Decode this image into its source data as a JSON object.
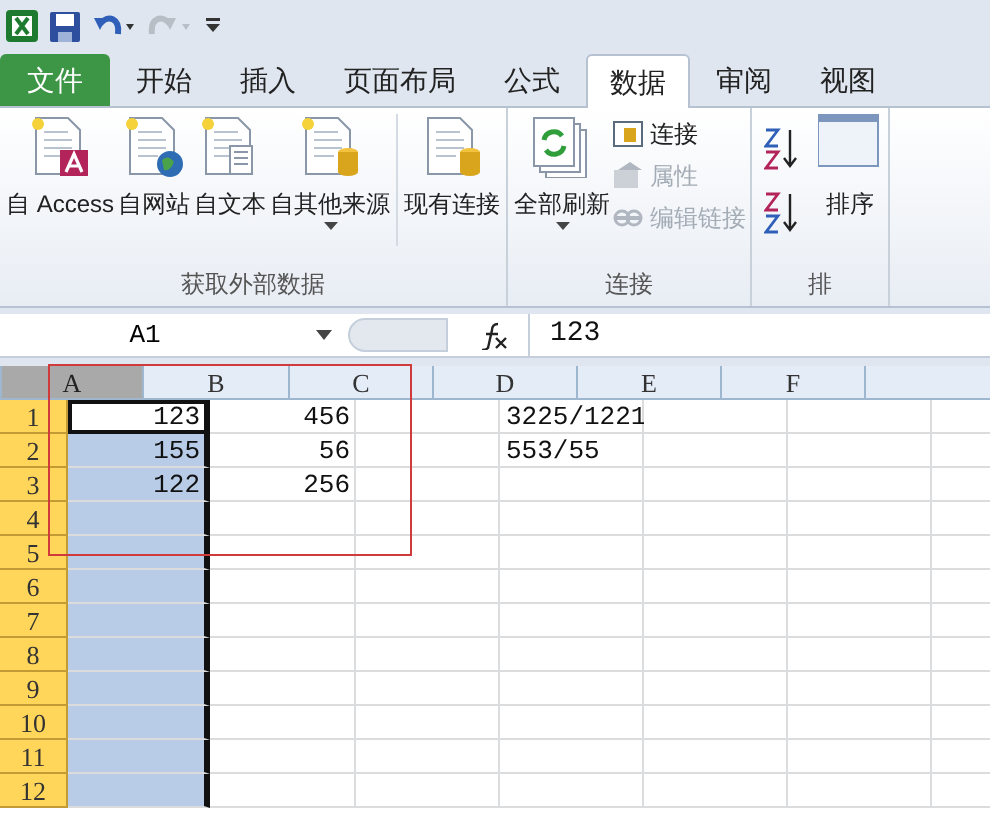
{
  "quick_access": {
    "redo_disabled": true
  },
  "tabs": [
    {
      "label": "文件",
      "kind": "file",
      "selected": false
    },
    {
      "label": "开始",
      "kind": "tab",
      "selected": false
    },
    {
      "label": "插入",
      "kind": "tab",
      "selected": false
    },
    {
      "label": "页面布局",
      "kind": "tab",
      "selected": false
    },
    {
      "label": "公式",
      "kind": "tab",
      "selected": false
    },
    {
      "label": "数据",
      "kind": "tab",
      "selected": true
    },
    {
      "label": "审阅",
      "kind": "tab",
      "selected": false
    },
    {
      "label": "视图",
      "kind": "tab",
      "selected": false
    }
  ],
  "ribbon": {
    "groups": [
      {
        "label": "获取外部数据",
        "buttons": [
          {
            "label": "自 Access",
            "kind": "large",
            "dropdown": false,
            "disabled": false
          },
          {
            "label": "自网站",
            "kind": "large",
            "dropdown": false,
            "disabled": false
          },
          {
            "label": "自文本",
            "kind": "large",
            "dropdown": false,
            "disabled": false
          },
          {
            "label": "自其他来源",
            "kind": "large",
            "dropdown": true,
            "disabled": false
          },
          {
            "label": "现有连接",
            "kind": "large",
            "dropdown": false,
            "disabled": false
          }
        ]
      },
      {
        "label": "连接",
        "buttons": [
          {
            "label": "全部刷新",
            "kind": "large",
            "dropdown": true,
            "disabled": false
          },
          {
            "label": "连接",
            "kind": "small",
            "dropdown": false,
            "disabled": false
          },
          {
            "label": "属性",
            "kind": "small",
            "dropdown": false,
            "disabled": true
          },
          {
            "label": "编辑链接",
            "kind": "small",
            "dropdown": false,
            "disabled": true
          }
        ]
      },
      {
        "label": "排",
        "buttons": [
          {
            "kind": "sort"
          },
          {
            "label": "排序",
            "kind": "large",
            "dropdown": false,
            "disabled": false
          }
        ]
      }
    ]
  },
  "formula_bar": {
    "name_box": "A1",
    "formula": "123"
  },
  "sheet": {
    "columns": [
      {
        "label": "A",
        "selected": true
      },
      {
        "label": "B",
        "selected": false
      },
      {
        "label": "C",
        "selected": false
      },
      {
        "label": "D",
        "selected": false
      },
      {
        "label": "E",
        "selected": false
      },
      {
        "label": "F",
        "selected": false
      }
    ],
    "rows": [
      {
        "label": "1",
        "cells": [
          {
            "kind": "number",
            "text": "123",
            "active": true
          },
          {
            "kind": "number",
            "text": "456",
            "active": false
          },
          null,
          {
            "kind": "text",
            "text": "3225/1221",
            "active": false
          }
        ]
      },
      {
        "label": "2",
        "cells": [
          {
            "kind": "number",
            "text": "155",
            "active": false
          },
          {
            "kind": "number",
            "text": "56",
            "active": false
          },
          null,
          {
            "kind": "text",
            "text": "553/55",
            "active": false
          }
        ]
      },
      {
        "label": "3",
        "cells": [
          {
            "kind": "number",
            "text": "122",
            "active": false
          },
          {
            "kind": "number",
            "text": "256",
            "active": false
          }
        ]
      },
      {
        "label": "4",
        "cells": []
      },
      {
        "label": "5",
        "cells": []
      },
      {
        "label": "6",
        "cells": []
      },
      {
        "label": "7",
        "cells": []
      },
      {
        "label": "8",
        "cells": []
      },
      {
        "label": "9",
        "cells": []
      },
      {
        "label": "10",
        "cells": []
      },
      {
        "label": "11",
        "cells": []
      },
      {
        "label": "12",
        "cells": []
      }
    ]
  },
  "annotation": {
    "kind": "rectangle"
  }
}
